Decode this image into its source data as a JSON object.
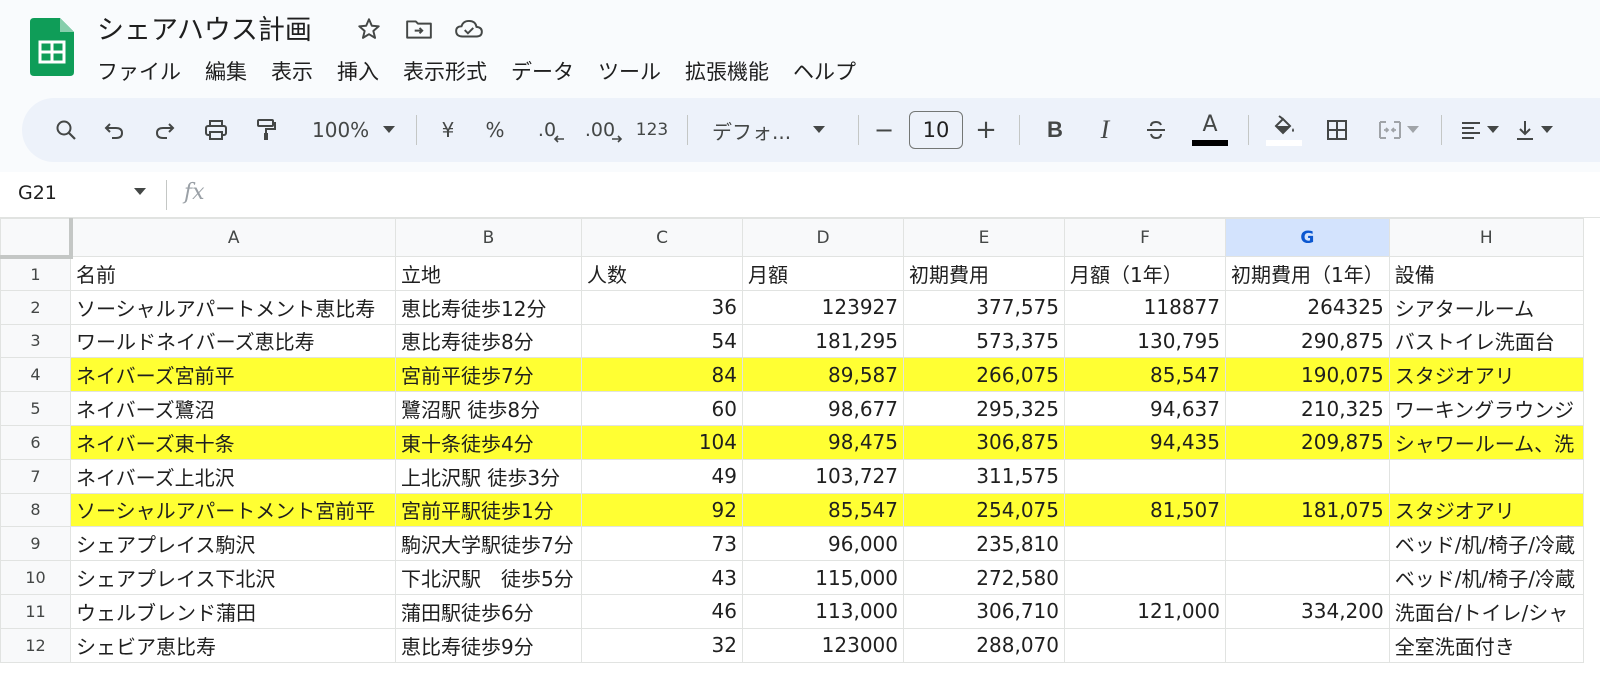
{
  "doc": {
    "title": "シェアハウス計画",
    "brand_color": "#0f9d58"
  },
  "title_icons": [
    "star-icon",
    "move-to-folder-icon",
    "cloud-saved-icon"
  ],
  "menu": [
    "ファイル",
    "編集",
    "表示",
    "挿入",
    "表示形式",
    "データ",
    "ツール",
    "拡張機能",
    "ヘルプ"
  ],
  "toolbar": {
    "zoom": "100%",
    "currency": "¥",
    "percent": "%",
    "decimal_decrease": ".0",
    "decimal_increase": ".00",
    "number_format": "123",
    "font": "デフォ...",
    "font_size": "10",
    "minus": "−",
    "plus": "+",
    "bold": "B",
    "italic": "I",
    "text_color_letter": "A"
  },
  "formula_bar": {
    "cell_ref": "G21",
    "fx": "fx"
  },
  "sheet": {
    "selected_column": "G",
    "highlight_color": "#ffff33",
    "columns": [
      "A",
      "B",
      "C",
      "D",
      "E",
      "F",
      "G",
      "H"
    ],
    "rows": [
      {
        "num": "1",
        "hl": false,
        "cells": [
          "名前",
          "立地",
          "人数",
          "月額",
          "初期費用",
          "月額（1年）",
          "初期費用（1年）",
          "設備"
        ]
      },
      {
        "num": "2",
        "hl": false,
        "cells": [
          "ソーシャルアパートメント恵比寿",
          "恵比寿徒歩12分",
          "36",
          "123927",
          "377,575",
          "118877",
          "264325",
          "シアタールーム"
        ]
      },
      {
        "num": "3",
        "hl": false,
        "cells": [
          "ワールドネイバーズ恵比寿",
          "恵比寿徒歩8分",
          "54",
          "181,295",
          "573,375",
          "130,795",
          "290,875",
          "バストイレ洗面台"
        ]
      },
      {
        "num": "4",
        "hl": true,
        "cells": [
          "ネイバーズ宮前平",
          "宮前平徒歩7分",
          "84",
          "89,587",
          "266,075",
          "85,547",
          "190,075",
          "スタジオアリ"
        ]
      },
      {
        "num": "5",
        "hl": false,
        "cells": [
          "ネイバーズ鷺沼",
          "鷺沼駅 徒歩8分",
          "60",
          "98,677",
          "295,325",
          "94,637",
          "210,325",
          "ワーキングラウンジ"
        ]
      },
      {
        "num": "6",
        "hl": true,
        "cells": [
          "ネイバーズ東十条",
          "東十条徒歩4分",
          "104",
          "98,475",
          "306,875",
          "94,435",
          "209,875",
          "シャワールーム、洗"
        ]
      },
      {
        "num": "7",
        "hl": false,
        "cells": [
          "ネイバーズ上北沢",
          "上北沢駅 徒歩3分",
          "49",
          "103,727",
          "311,575",
          "",
          "",
          ""
        ]
      },
      {
        "num": "8",
        "hl": true,
        "cells": [
          "ソーシャルアパートメント宮前平",
          "宮前平駅徒歩1分",
          "92",
          "85,547",
          "254,075",
          "81,507",
          "181,075",
          "スタジオアリ"
        ]
      },
      {
        "num": "9",
        "hl": false,
        "cells": [
          "シェアプレイス駒沢",
          "駒沢大学駅徒歩7分",
          "73",
          "96,000",
          "235,810",
          "",
          "",
          "ベッド/机/椅子/冷蔵"
        ]
      },
      {
        "num": "10",
        "hl": false,
        "cells": [
          "シェアプレイス下北沢",
          "下北沢駅　徒歩5分",
          "43",
          "115,000",
          "272,580",
          "",
          "",
          "ベッド/机/椅子/冷蔵"
        ]
      },
      {
        "num": "11",
        "hl": false,
        "cells": [
          "ウェルブレンド蒲田",
          "蒲田駅徒歩6分",
          "46",
          "113,000",
          "306,710",
          "121,000",
          "334,200",
          "洗面台/トイレ/シャ"
        ]
      },
      {
        "num": "12",
        "hl": false,
        "cells": [
          "シェビア恵比寿",
          "恵比寿徒歩9分",
          "32",
          "123000",
          "288,070",
          "",
          "",
          "全室洗面付き"
        ]
      }
    ]
  }
}
